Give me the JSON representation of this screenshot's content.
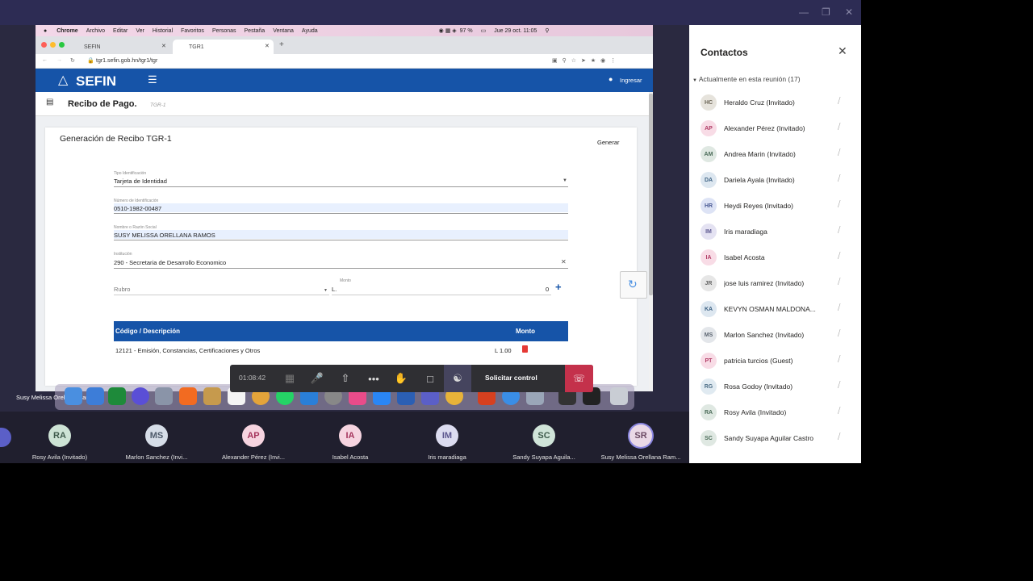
{
  "mac_menubar": {
    "items": [
      "Chrome",
      "Archivo",
      "Editar",
      "Ver",
      "Historial",
      "Favoritos",
      "Personas",
      "Pestaña",
      "Ventana",
      "Ayuda"
    ],
    "battery": "97 %",
    "datetime": "Jue 29 oct. 11:05"
  },
  "browser": {
    "tabs": [
      {
        "label": "SEFIN"
      },
      {
        "label": "TGR1"
      }
    ],
    "new_tab": "+",
    "url": "tgr1.sefin.gob.hn/tgr1/tgr"
  },
  "sefin": {
    "logo_text": "SEFIN",
    "login_label": "Ingresar",
    "page_title": "Recibo de Pago.",
    "page_subtitle": "TGR-1",
    "card_title": "Generación de Recibo TGR-1",
    "generate_label": "Generar",
    "fields": {
      "tipo_label": "Tipo Identificación",
      "tipo_value": "Tarjeta de Identidad",
      "numero_label": "Número de Identificación",
      "numero_value": "0510-1982-00487",
      "nombre_label": "Nombre o Razón Social",
      "nombre_value": "SUSY MELISSA ORELLANA RAMOS",
      "inst_label": "Institución",
      "inst_value": "290 - Secretaria de Desarrollo Economico",
      "rubro_label": "Rubro",
      "monto_label": "Monto",
      "monto_prefix": "L.",
      "monto_value": "0"
    },
    "table": {
      "headers": [
        "Código / Descripción",
        "Monto"
      ],
      "rows": [
        {
          "desc": "12121 - Emisión, Constancias, Certificaciones y Otros",
          "amount": "L 1.00"
        }
      ]
    }
  },
  "meeting": {
    "timer": "01:08:42",
    "request_control": "Solicitar control",
    "sharer_name": "Susy Melissa Orellana Ramos"
  },
  "participants_strip": [
    {
      "initials": "RA",
      "name": "Rosy Avila (Invitado)",
      "color": "#cde3d5"
    },
    {
      "initials": "MS",
      "name": "Marlon Sanchez (Invi...",
      "color": "#d6dde8"
    },
    {
      "initials": "AP",
      "name": "Alexander Pérez (Invi...",
      "color": "#f6d4e0"
    },
    {
      "initials": "IA",
      "name": "Isabel Acosta",
      "color": "#f6d4e0"
    },
    {
      "initials": "IM",
      "name": "Iris maradiaga",
      "color": "#dcdcf0"
    },
    {
      "initials": "SC",
      "name": "Sandy Suyapa Aguila...",
      "color": "#d0e4d9"
    },
    {
      "initials": "SR",
      "name": "Susy Melissa Orellana Ram...",
      "color": "#ead9e6"
    }
  ],
  "panel": {
    "title": "Contactos",
    "section": "Actualmente en esta reunión (17)",
    "contacts": [
      {
        "initials": "HC",
        "name": "Heraldo Cruz (Invitado)",
        "bg": "#e6e3dc",
        "fg": "#6b6556"
      },
      {
        "initials": "AP",
        "name": "Alexander Pérez (Invitado)",
        "bg": "#f8dce6",
        "fg": "#b03a64"
      },
      {
        "initials": "AM",
        "name": "Andrea Marin (Invitado)",
        "bg": "#dfe8e2",
        "fg": "#4a6b58"
      },
      {
        "initials": "DA",
        "name": "Dariela Ayala (Invitado)",
        "bg": "#dde7f0",
        "fg": "#3f6384"
      },
      {
        "initials": "HR",
        "name": "Heydi Reyes (Invitado)",
        "bg": "#dde3f5",
        "fg": "#4a5a94"
      },
      {
        "initials": "IM",
        "name": "Iris maradiaga",
        "bg": "#e4e2f2",
        "fg": "#5c578f"
      },
      {
        "initials": "IA",
        "name": "Isabel Acosta",
        "bg": "#f8dce6",
        "fg": "#b03a64"
      },
      {
        "initials": "JR",
        "name": "jose luis ramirez (Invitado)",
        "bg": "#e6e6e6",
        "fg": "#666"
      },
      {
        "initials": "KA",
        "name": "KEVYN OSMAN MALDONA...",
        "bg": "#dde7f0",
        "fg": "#3f6384"
      },
      {
        "initials": "MS",
        "name": "Marlon Sanchez (Invitado)",
        "bg": "#e3e6ea",
        "fg": "#5b6470"
      },
      {
        "initials": "PT",
        "name": "patricia turcios (Guest)",
        "bg": "#f8dce6",
        "fg": "#b03a64"
      },
      {
        "initials": "RG",
        "name": "Rosa Godoy (Invitado)",
        "bg": "#e0eaf1",
        "fg": "#4d6e86"
      },
      {
        "initials": "RA",
        "name": "Rosy Avila (Invitado)",
        "bg": "#dfe8e2",
        "fg": "#4a6b58"
      },
      {
        "initials": "SC",
        "name": "Sandy Suyapa Aguilar Castro",
        "bg": "#dfe8e2",
        "fg": "#4a6b58"
      }
    ]
  }
}
